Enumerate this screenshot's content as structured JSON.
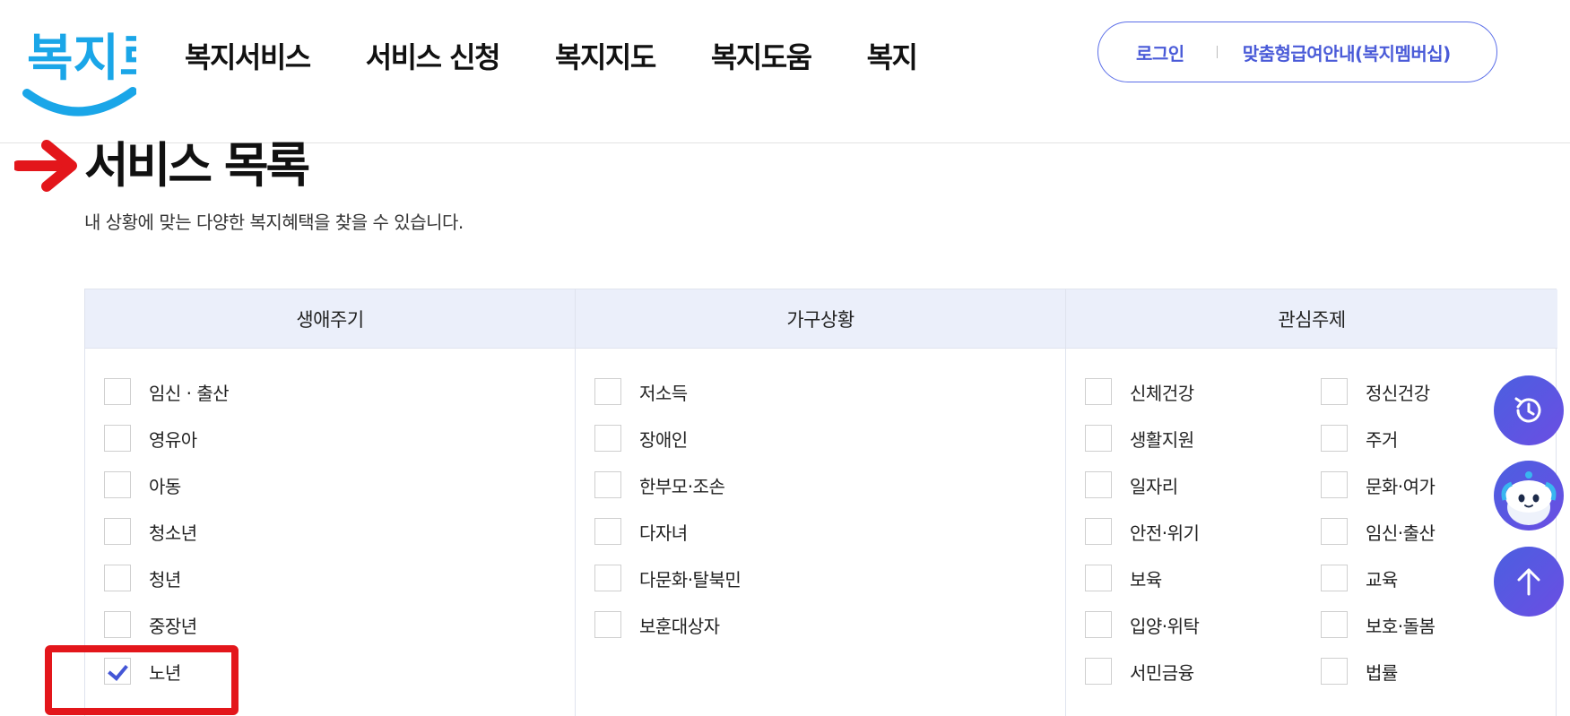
{
  "header": {
    "logo_text": "복지로",
    "nav": [
      "복지서비스",
      "서비스 신청",
      "복지지도",
      "복지도움",
      "복지"
    ],
    "login_label": "로그인",
    "membership_label": "맞춤형급여안내(복지멤버십)"
  },
  "page": {
    "title": "서비스 목록",
    "description": "내 상황에 맞는 다양한 복지혜택을 찾을 수 있습니다."
  },
  "filters": {
    "life_cycle": {
      "header": "생애주기",
      "options": [
        {
          "label": "임신 · 출산",
          "checked": false
        },
        {
          "label": "영유아",
          "checked": false
        },
        {
          "label": "아동",
          "checked": false
        },
        {
          "label": "청소년",
          "checked": false
        },
        {
          "label": "청년",
          "checked": false
        },
        {
          "label": "중장년",
          "checked": false
        },
        {
          "label": "노년",
          "checked": true
        }
      ]
    },
    "household": {
      "header": "가구상황",
      "options": [
        {
          "label": "저소득",
          "checked": false
        },
        {
          "label": "장애인",
          "checked": false
        },
        {
          "label": "한부모·조손",
          "checked": false
        },
        {
          "label": "다자녀",
          "checked": false
        },
        {
          "label": "다문화·탈북민",
          "checked": false
        },
        {
          "label": "보훈대상자",
          "checked": false
        }
      ]
    },
    "interest": {
      "header": "관심주제",
      "options": [
        {
          "label": "신체건강",
          "checked": false
        },
        {
          "label": "정신건강",
          "checked": false
        },
        {
          "label": "생활지원",
          "checked": false
        },
        {
          "label": "주거",
          "checked": false
        },
        {
          "label": "일자리",
          "checked": false
        },
        {
          "label": "문화·여가",
          "checked": false
        },
        {
          "label": "안전·위기",
          "checked": false
        },
        {
          "label": "임신·출산",
          "checked": false
        },
        {
          "label": "보육",
          "checked": false
        },
        {
          "label": "교육",
          "checked": false
        },
        {
          "label": "입양·위탁",
          "checked": false
        },
        {
          "label": "보호·돌봄",
          "checked": false
        },
        {
          "label": "서민금융",
          "checked": false
        },
        {
          "label": "법률",
          "checked": false
        }
      ]
    }
  },
  "floating": {
    "icons": [
      "recent-history-icon",
      "chatbot-icon",
      "scroll-top-arrow-icon"
    ]
  },
  "colors": {
    "accent": "#4a5bd8",
    "header_bg": "#ebeffa",
    "highlight_red": "#e3161b",
    "fab_gradient_start": "#4b5fe0",
    "fab_gradient_end": "#6b4ee3"
  }
}
